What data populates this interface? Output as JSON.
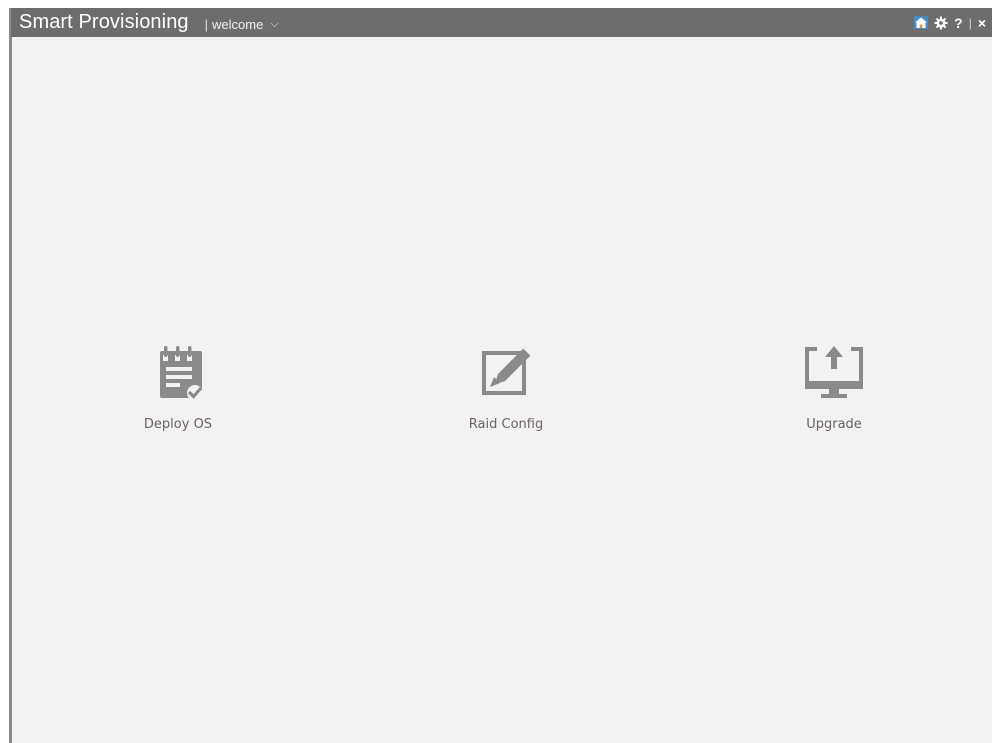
{
  "header": {
    "app_title": "Smart Provisioning",
    "page_separator": "|",
    "page_name": "welcome",
    "page_chevron": "⌵",
    "controls": {
      "home_icon": "home-icon",
      "settings_icon": "gear-icon",
      "help_label": "?",
      "separator": "|",
      "close_label": "×"
    }
  },
  "main": {
    "tiles": [
      {
        "label": "Deploy OS",
        "icon": "notepad-check-icon"
      },
      {
        "label": "Raid Config",
        "icon": "edit-pencil-icon"
      },
      {
        "label": "Upgrade",
        "icon": "monitor-upload-icon"
      }
    ]
  },
  "colors": {
    "titlebar": "#6d6d6d",
    "content_bg": "#f2f2f2",
    "icon_gray": "#8a8a8a",
    "label_text": "#6e6262"
  }
}
